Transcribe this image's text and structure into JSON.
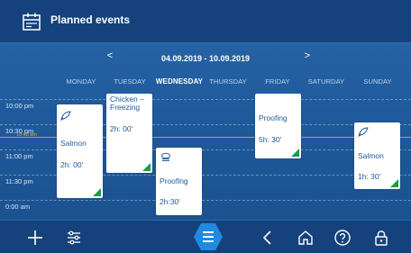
{
  "header": {
    "title": "Planned events"
  },
  "week_nav": {
    "range": "04.09.2019 - 10.09.2019",
    "prev": "<",
    "next": ">"
  },
  "days": [
    {
      "label": "MONDAY",
      "active": false
    },
    {
      "label": "TUESDAY",
      "active": false
    },
    {
      "label": "WEDNESDAY",
      "active": true
    },
    {
      "label": "THURSDAY",
      "active": false
    },
    {
      "label": "FRIDAY",
      "active": false
    },
    {
      "label": "SATURDAY",
      "active": false
    },
    {
      "label": "SUNDAY",
      "active": false
    }
  ],
  "times": [
    "10:00 pm",
    "10:30 pm",
    "11:00 pm",
    "11:30 pm",
    "0:00 am"
  ],
  "now": {
    "label": "10:48 am"
  },
  "events": {
    "monday": {
      "name": "Salmon",
      "duration": "2h: 00'"
    },
    "tuesday": {
      "name": "Chicken – Freezing",
      "duration": "2h: 00'"
    },
    "wednesday": {
      "name": "Proofing",
      "duration": "2h:30'"
    },
    "friday": {
      "name": "Proofing",
      "duration": "5h: 30'"
    },
    "sunday": {
      "name": "Salmon",
      "duration": "1h: 30'"
    }
  },
  "colors": {
    "accent": "#f08a24",
    "header": "#15427c",
    "background": "#1f5a9c",
    "event_corner": "#1e9a50"
  },
  "icons": {
    "title": "calendar-icon",
    "add": "plus-icon",
    "filter": "sliders-icon",
    "menu": "menu-icon",
    "back": "chevron-left-icon",
    "home": "home-icon",
    "help": "help-icon",
    "lock": "lock-icon"
  }
}
